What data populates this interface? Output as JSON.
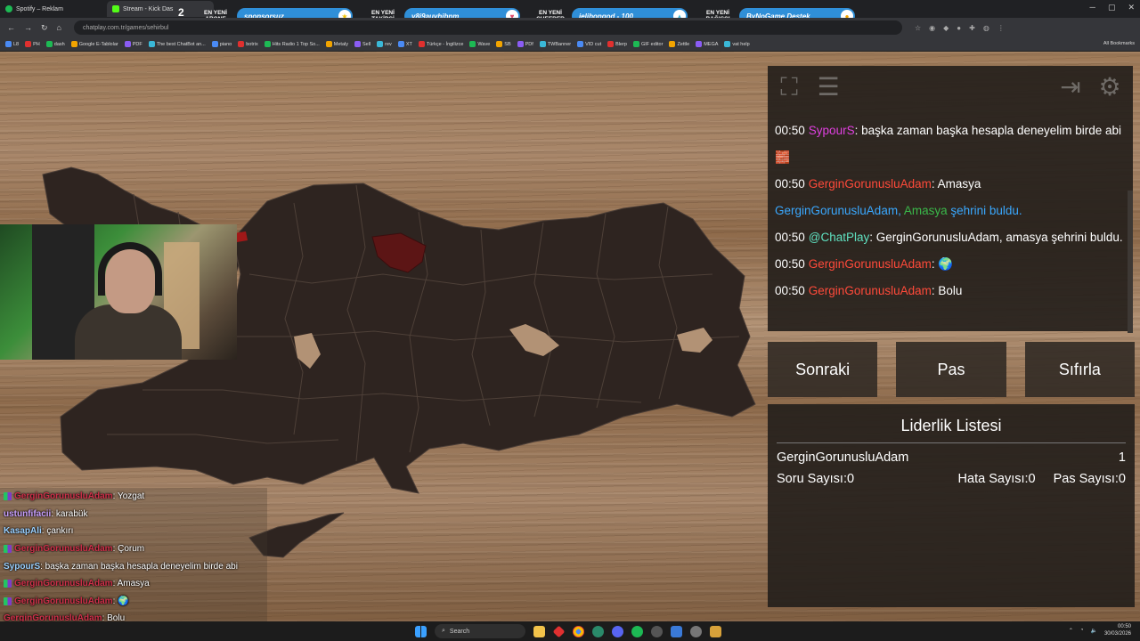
{
  "browser": {
    "tabs": [
      {
        "title": "Spotify – Reklam",
        "color": "#1db954"
      },
      {
        "title": "Stream - Kick Das",
        "color": "#53fc18"
      }
    ],
    "url": "chatplay.com.tr/games/sehirbul",
    "bookmarks": [
      "L8",
      "PH",
      "dash",
      "Google E-Tablolar",
      "PDF",
      "The best ChatBot an...",
      "piano",
      "botrix",
      "Hits Radio 1 Top So...",
      "Metaly",
      "Sell",
      "rev",
      "XT",
      "Türkçe - İngilizce",
      "Wave",
      "SB",
      "PDf",
      "TWBanner",
      "VID cut",
      "Blerp",
      "GIF editor",
      "Zettle",
      "MEGA",
      "vat help"
    ],
    "all_bookmarks": "All Bookmarks"
  },
  "alerts": {
    "subscriber_count": "2",
    "items": [
      {
        "label": "EN YENİ ABONE",
        "value": "sponsorsuz",
        "color": "#2f8fd8",
        "icon_color": "#f2c200",
        "icon": "star-icon",
        "glyph": "★"
      },
      {
        "label": "EN YENİ TAKİPÇİ",
        "value": "v8i9auvhibnm",
        "color": "#2f8fd8",
        "icon_color": "#e04a6a",
        "icon": "heart-icon",
        "glyph": "♥"
      },
      {
        "label": "EN YENİ CHEERER",
        "value": "jelibongod - 100",
        "color": "#2f8fd8",
        "icon_color": "#48b8d8",
        "icon": "bits-icon",
        "glyph": "▲"
      },
      {
        "label": "EN YENİ BAĞIŞÇI",
        "value": "ByNoGame Destek",
        "color": "#2f8fd8",
        "icon_color": "#f2a400",
        "icon": "coin-icon",
        "glyph": "●"
      }
    ]
  },
  "stream_chat": [
    {
      "user": "GerginGorunusluAdam",
      "msg": "Yozgat",
      "color": "#d0304a",
      "badge": true
    },
    {
      "user": "ustunfifacii",
      "msg": "karabük",
      "color": "#c9a0ff",
      "badge": false
    },
    {
      "user": "KasapAli",
      "msg": "çankırı",
      "color": "#9ad0ff",
      "badge": false
    },
    {
      "user": "GerginGorunusluAdam",
      "msg": "Çorum",
      "color": "#d0304a",
      "badge": true
    },
    {
      "user": "SypourS",
      "msg": "başka zaman başka hesapla deneyelim birde abi",
      "color": "#9ad0ff",
      "badge": false
    },
    {
      "user": "GerginGorunusluAdam",
      "msg": "Amasya",
      "color": "#d0304a",
      "badge": true
    },
    {
      "user": "GerginGorunusluAdam",
      "msg": "🌍",
      "color": "#d0304a",
      "badge": true
    },
    {
      "user": "GerginGorunusluAdam",
      "msg": "Bolu",
      "color": "#d0304a",
      "badge": false
    }
  ],
  "game_chat": [
    {
      "time": "00:50",
      "user": "SypourS",
      "user_color": "#e040e0",
      "msg": ": başka zaman başka hesapla deneyelim birde abi 🧱"
    },
    {
      "time": "00:50",
      "user": "GerginGorunusluAdam",
      "user_color": "#ff4a3a",
      "msg": ": Amasya"
    },
    {
      "time": "",
      "user": "GerginGorunusluAdam,",
      "user_color": "#3aa8ff",
      "city": "Amasya",
      "city_color": "#3ab84a",
      "msg": " şehrini buldu.",
      "msg_color": "#3aa8ff"
    },
    {
      "time": "00:50",
      "user": "@ChatPlay",
      "user_color": "#5fe0c0",
      "msg": ": GerginGorunusluAdam, amasya şehrini buldu."
    },
    {
      "time": "00:50",
      "user": "GerginGorunusluAdam",
      "user_color": "#ff4a3a",
      "msg": ": 🌍"
    },
    {
      "time": "00:50",
      "user": "GerginGorunusluAdam",
      "user_color": "#ff4a3a",
      "msg": ": Bolu"
    }
  ],
  "buttons": {
    "next": "Sonraki",
    "pass": "Pas",
    "reset": "Sıfırla"
  },
  "leaderboard": {
    "title": "Liderlik Listesi",
    "rows": [
      {
        "name": "GerginGorunusluAdam",
        "score": "1"
      }
    ],
    "question_count": "Soru Sayısı:0",
    "error_count": "Hata Sayısı:0",
    "pass_count": "Pas Sayısı:0"
  },
  "map": {
    "fill_color": "#2e2420",
    "highlight_color": "#6b1414",
    "found_city_color": "#a01818"
  },
  "taskbar": {
    "search": "Search",
    "time": "00:50",
    "date": "30/03/2026"
  }
}
